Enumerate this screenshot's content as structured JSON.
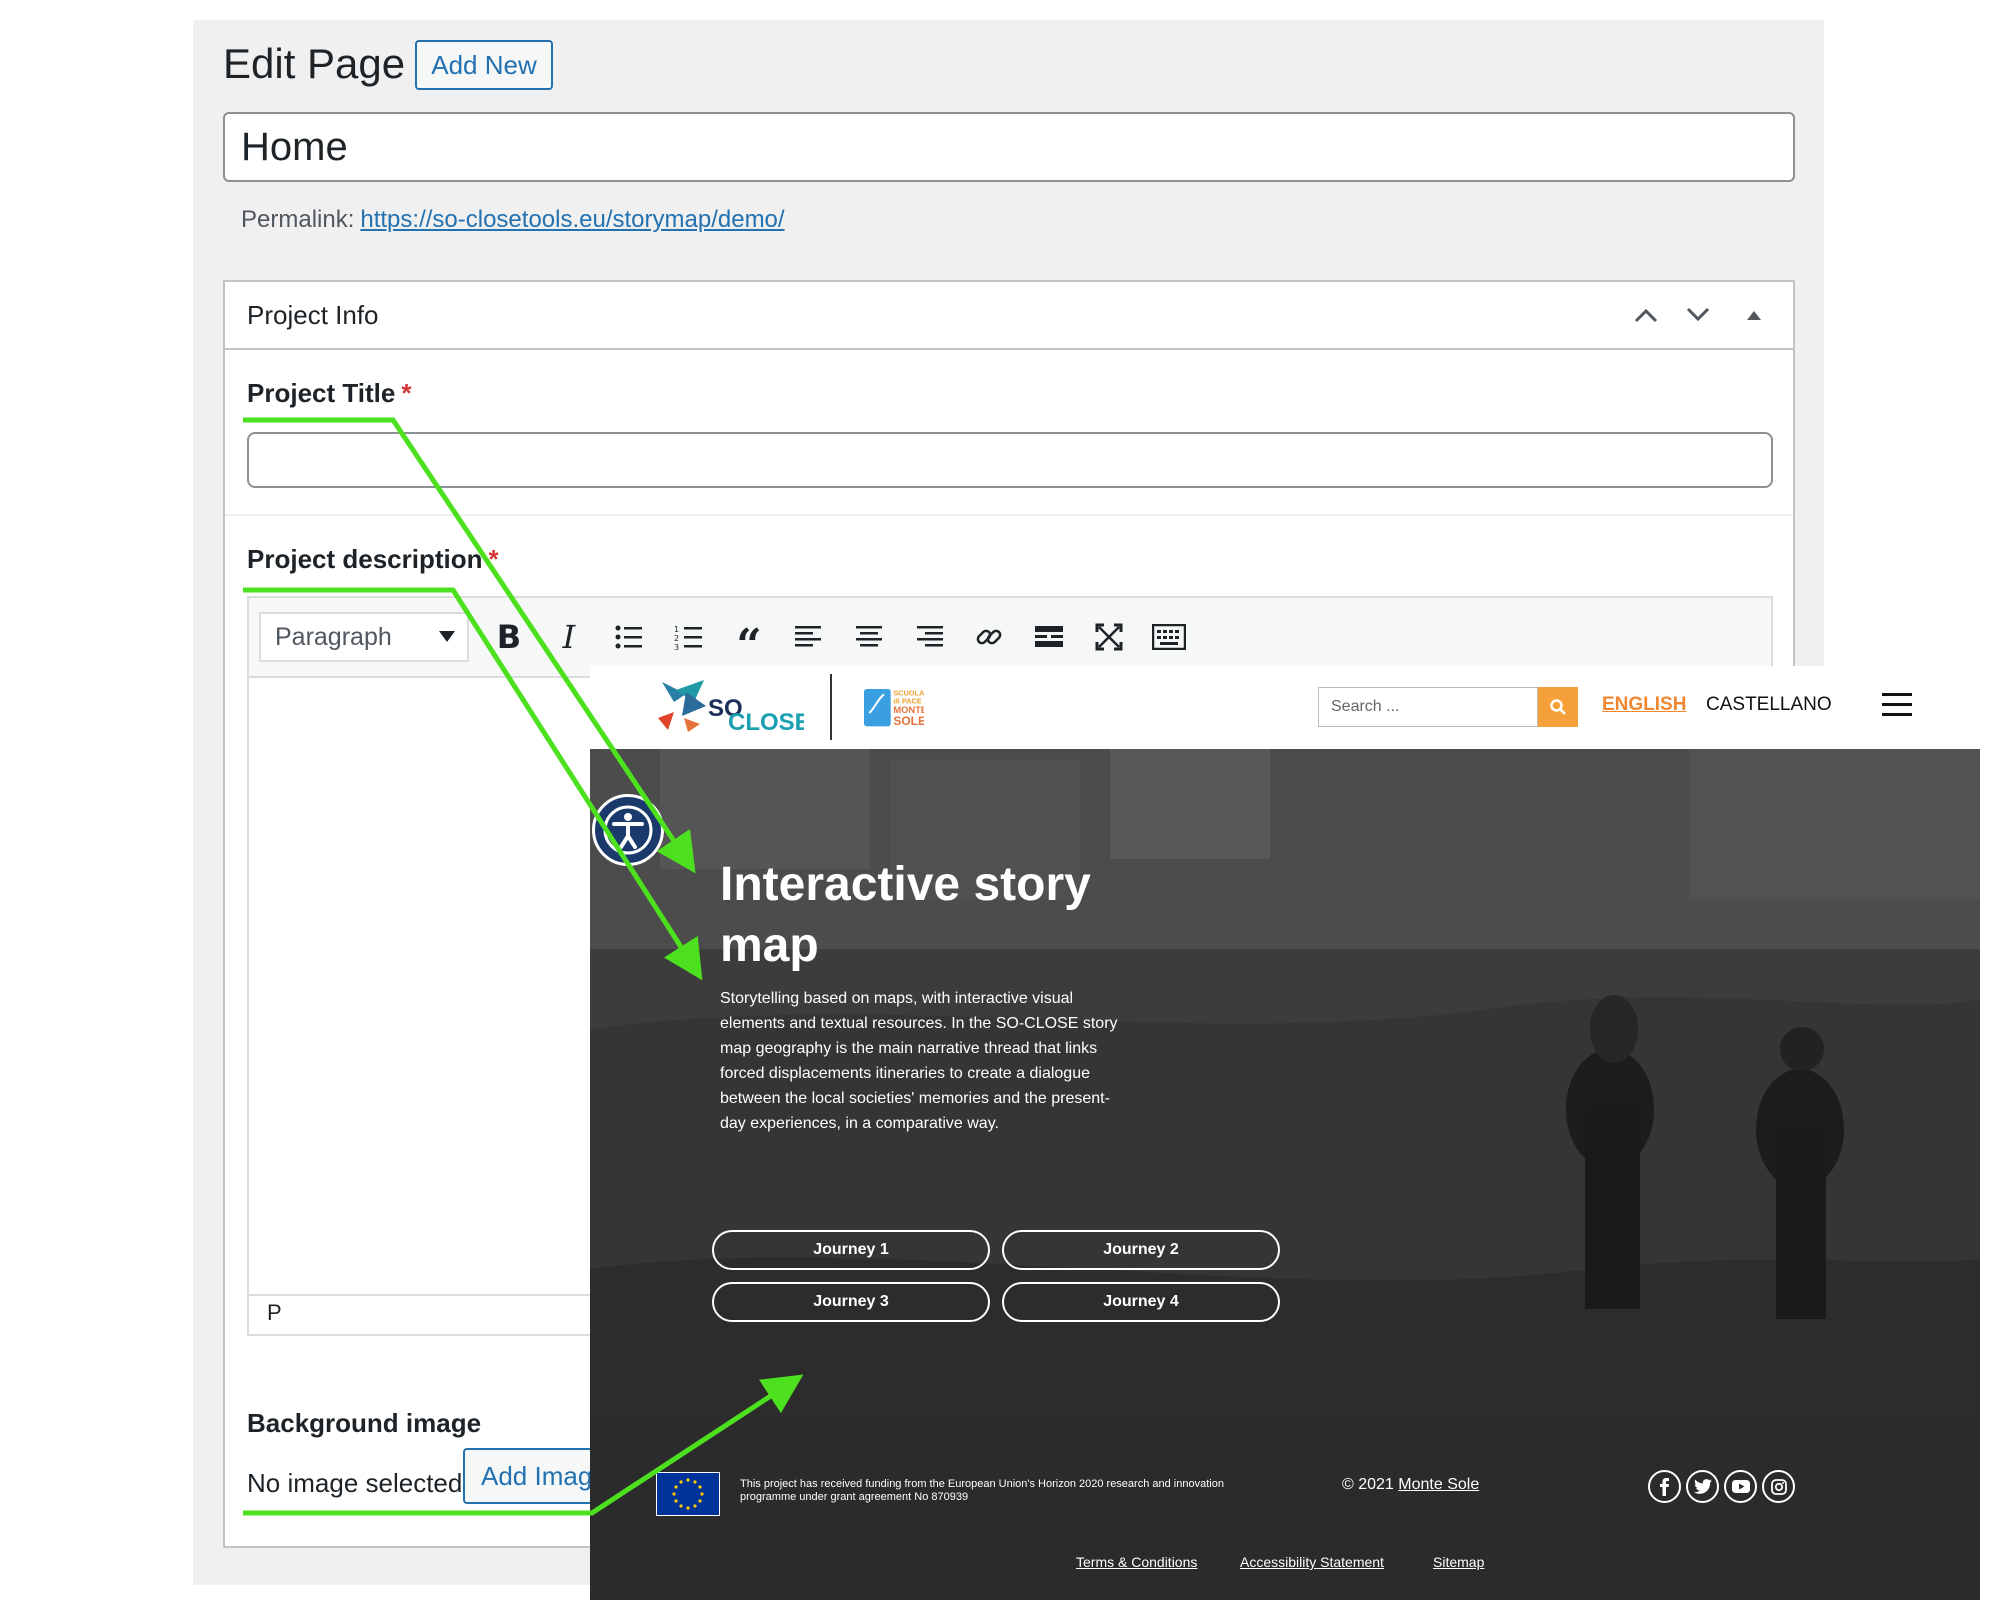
{
  "editor": {
    "heading": "Edit Page",
    "add_new": "Add New",
    "page_title": "Home",
    "permalink_label": "Permalink:",
    "permalink_url": "https://so-closetools.eu/storymap/demo/",
    "metabox": {
      "title": "Project Info",
      "project_title_label": "Project Title",
      "project_description_label": "Project description",
      "required_mark": "*",
      "format_select": "Paragraph",
      "status_path": "P",
      "background_label": "Background image",
      "no_image": "No image selected",
      "add_image": "Add Image"
    }
  },
  "site": {
    "search_placeholder": "Search ...",
    "lang_active": "ENGLISH",
    "lang_other": "CASTELLANO",
    "logo_text_so": "SO",
    "logo_text_close": "CLOSE",
    "logo2_text": [
      "SCUOLA",
      "di PACE",
      "MONTE",
      "SOLE"
    ],
    "hero_title": "Interactive story map",
    "hero_description": "Storytelling based on maps, with interactive visual elements and textual resources. In the SO-CLOSE story map geography is the main narrative thread that links forced displacements itineraries to create a dialogue between the local societies' memories and the present-day experiences, in a comparative way.",
    "journeys": [
      "Journey 1",
      "Journey 2",
      "Journey 3",
      "Journey 4"
    ],
    "funding_text": "This project has received funding from the European Union's Horizon 2020 research and innovation programme under grant agreement No 870939",
    "copyright_prefix": "© 2021",
    "copyright_link": "Monte Sole",
    "footer_links": [
      "Terms & Conditions",
      "Accessibility Statement",
      "Sitemap"
    ]
  },
  "colors": {
    "wp_blue": "#2271b1",
    "required_red": "#d63638",
    "arrow_green": "#4ce01e",
    "accent_orange": "#f5a03a",
    "hero_dark": "#2b2b2b"
  }
}
